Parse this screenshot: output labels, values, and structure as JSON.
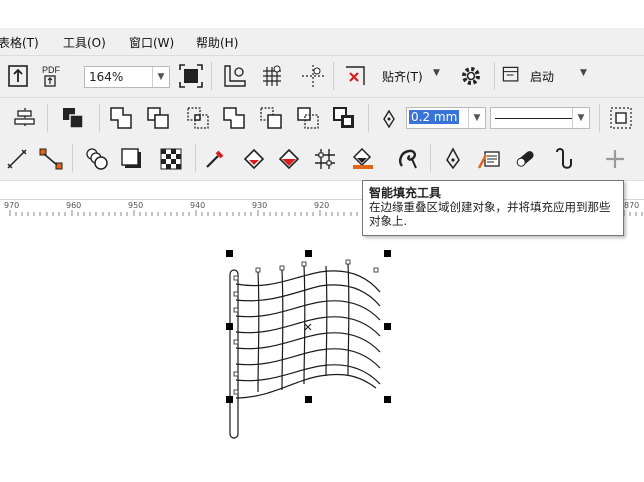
{
  "menu": [
    {
      "label": "表格(T)",
      "name": "menu-table"
    },
    {
      "label": "工具(O)",
      "name": "menu-tools"
    },
    {
      "label": "窗口(W)",
      "name": "menu-window"
    },
    {
      "label": "帮助(H)",
      "name": "menu-help"
    }
  ],
  "toolbar_standard": {
    "zoom_value": "164%",
    "snap_label": "贴齐(T)",
    "launch_label": "启动",
    "icons": [
      "import-icon",
      "export-pdf-icon",
      "full-screen-icon",
      "show-rulers-icon",
      "show-grid-icon",
      "show-guidelines-icon",
      "snap-off-icon",
      "options-icon",
      "app-launcher-icon"
    ]
  },
  "toolbar_property": {
    "outline_width": "0.2 mm",
    "icons": [
      "align-icon",
      "group-icon",
      "weld-icon",
      "trim-icon",
      "intersect-icon",
      "simplify-icon",
      "front-minus-back-icon",
      "back-minus-front-icon",
      "boundary-icon",
      "pen-nib-icon",
      "wrap-text-icon"
    ]
  },
  "toolbar_tools": {
    "icons": [
      "dimension-tool-icon",
      "connector-tool-icon",
      "blend-tool-icon",
      "drop-shadow-tool-icon",
      "transparency-tool-icon",
      "eyedropper-tool-icon",
      "interactive-fill-tool-icon",
      "mesh-fill-tool-icon",
      "mesh-grid-icon",
      "smart-fill-tool-icon",
      "smart-drawing-icon",
      "pen-tool-icon",
      "bspline-icon",
      "eraser-icon",
      "shape-tool-icon",
      "add-tool-icon"
    ]
  },
  "ruler": {
    "labels": [
      "970",
      "960",
      "950",
      "940",
      "930",
      "920",
      "870"
    ]
  },
  "tooltip": {
    "title": "智能填充工具",
    "description": "在边缘重叠区域创建对象，并将填充应用到那些对象上."
  },
  "colors": {
    "accent_highlight": "#e02020",
    "toolbar_bg": "#f0f0f0",
    "selection_blue": "#3874d8"
  }
}
